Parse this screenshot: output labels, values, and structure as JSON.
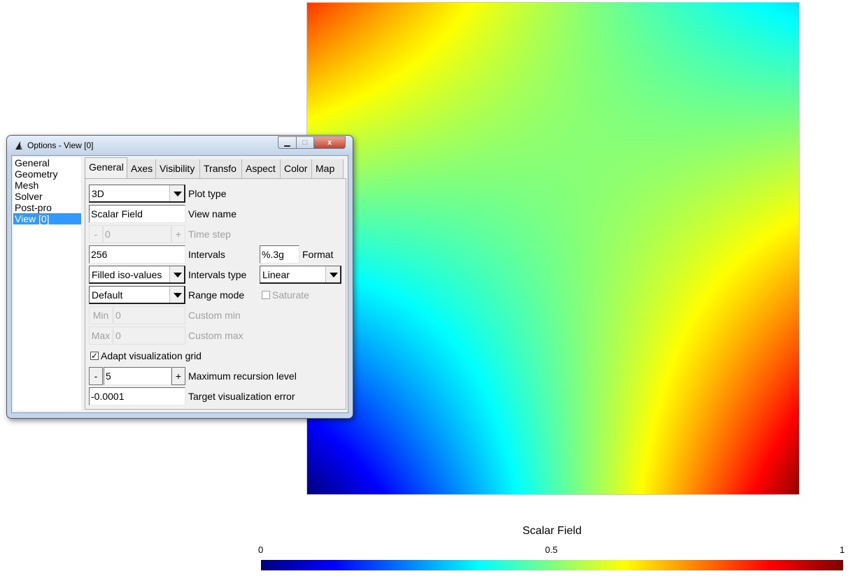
{
  "plot": {
    "colormap": [
      "#00007f",
      "#0000ff",
      "#007fff",
      "#00ffff",
      "#7fff7f",
      "#ffff00",
      "#ff7f00",
      "#ff0000",
      "#7f0000"
    ]
  },
  "colorbar": {
    "title": "Scalar Field",
    "ticks": [
      "0",
      "0.5",
      "1"
    ]
  },
  "window": {
    "title": "Options - View [0]",
    "min_label": "▁",
    "max_label": "□",
    "close_label": "x"
  },
  "categories": {
    "items": [
      "General",
      "Geometry",
      "Mesh",
      "Solver",
      "Post-pro",
      "View [0]"
    ],
    "selected": "View [0]"
  },
  "tabs": [
    "General",
    "Axes",
    "Visibility",
    "Transfo",
    "Aspect",
    "Color",
    "Map"
  ],
  "general": {
    "plot_type": {
      "value": "3D",
      "label": "Plot type"
    },
    "view_name": {
      "value": "Scalar Field",
      "label": "View name"
    },
    "time_step": {
      "minus": "-",
      "value": "0",
      "plus": "+",
      "label": "Time step"
    },
    "intervals": {
      "value": "256",
      "label": "Intervals"
    },
    "format": {
      "value": "%.3g",
      "label": "Format"
    },
    "intervals_type_mode": {
      "value": "Filled iso-values",
      "label": "Intervals type"
    },
    "intervals_type": {
      "value": "Linear"
    },
    "range_mode": {
      "value": "Default",
      "label": "Range mode"
    },
    "saturate": {
      "label": "Saturate",
      "checked": false
    },
    "custom_min": {
      "button": "Min",
      "value": "0",
      "label": "Custom min"
    },
    "custom_max": {
      "button": "Max",
      "value": "0",
      "label": "Custom max"
    },
    "adapt_grid": {
      "label": "Adapt visualization grid",
      "checked": true,
      "mark": "✓"
    },
    "recursion": {
      "minus": "-",
      "value": "5",
      "plus": "+",
      "label": "Maximum recursion level"
    },
    "target_error": {
      "value": "-0.0001",
      "label": "Target visualization error"
    }
  }
}
